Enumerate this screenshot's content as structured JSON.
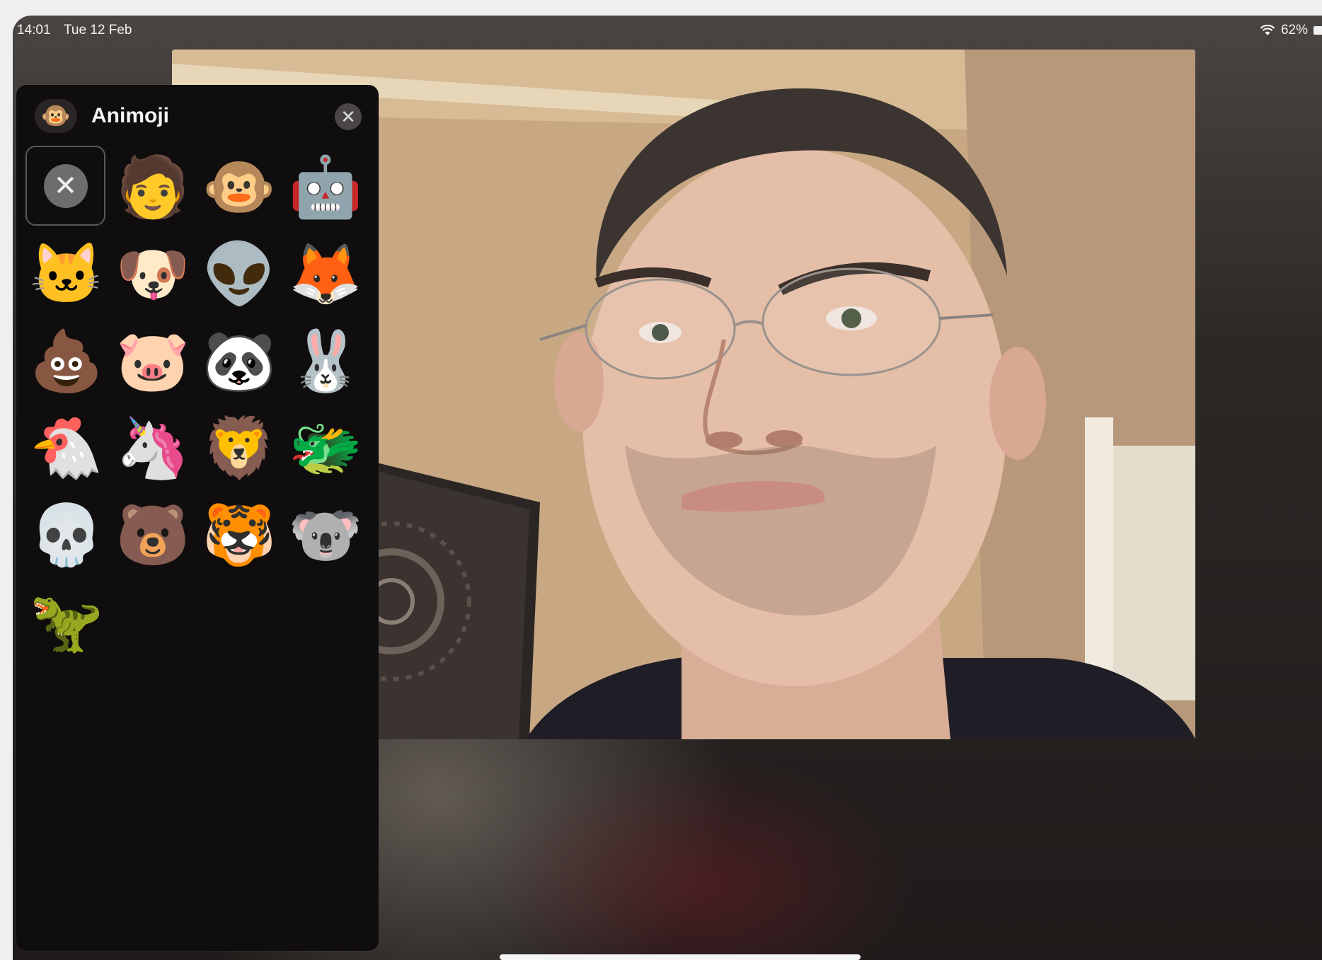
{
  "status_bar": {
    "time": "14:01",
    "date": "Tue 12 Feb",
    "battery": "62%"
  },
  "panel": {
    "title": "Animoji",
    "logo_emoji": "🐵",
    "close_glyph": "✕",
    "none_glyph": "✕",
    "items": [
      {
        "name": "memoji",
        "glyph": "🧑"
      },
      {
        "name": "monkey",
        "glyph": "🐵"
      },
      {
        "name": "robot",
        "glyph": "🤖"
      },
      {
        "name": "cat",
        "glyph": "🐱"
      },
      {
        "name": "dog",
        "glyph": "🐶"
      },
      {
        "name": "alien",
        "glyph": "👽"
      },
      {
        "name": "fox",
        "glyph": "🦊"
      },
      {
        "name": "poo",
        "glyph": "💩"
      },
      {
        "name": "pig",
        "glyph": "🐷"
      },
      {
        "name": "panda",
        "glyph": "🐼"
      },
      {
        "name": "rabbit",
        "glyph": "🐰"
      },
      {
        "name": "chicken",
        "glyph": "🐔"
      },
      {
        "name": "unicorn",
        "glyph": "🦄"
      },
      {
        "name": "lion",
        "glyph": "🦁"
      },
      {
        "name": "dragon",
        "glyph": "🐲"
      },
      {
        "name": "skull",
        "glyph": "💀"
      },
      {
        "name": "bear",
        "glyph": "🐻"
      },
      {
        "name": "tiger",
        "glyph": "🐯"
      },
      {
        "name": "koala",
        "glyph": "🐨"
      },
      {
        "name": "t-rex",
        "glyph": "🦖"
      }
    ]
  },
  "colors": {
    "panel_bg": "#0f0d0d",
    "selected_border": "#5a5858"
  }
}
